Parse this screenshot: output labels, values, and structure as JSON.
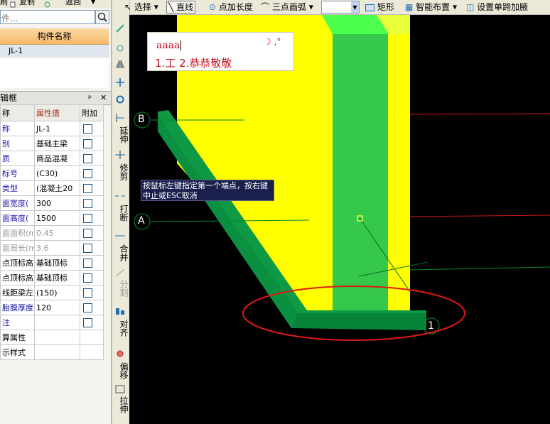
{
  "top_left_toolbar": {
    "item1": "刷",
    "item2": "复制",
    "item3": "返回"
  },
  "search": {
    "value": "件..."
  },
  "components": {
    "header": "构件名称",
    "items": [
      "JL-1"
    ]
  },
  "properties": {
    "title": "辑框",
    "pin": "ᵖ",
    "close": "✕",
    "columns": {
      "name": "称",
      "value": "属性值",
      "extra": "附加"
    },
    "rows": [
      {
        "name": "称",
        "value": "JL-1",
        "name_style": "blue",
        "value_style": "",
        "check": false
      },
      {
        "name": "别",
        "value": "基础主梁",
        "name_style": "blue",
        "value_style": "",
        "check": true
      },
      {
        "name": "质",
        "value": "商品混凝",
        "name_style": "blue",
        "value_style": "",
        "check": true
      },
      {
        "name": "标号",
        "value": "(C30)",
        "name_style": "blue",
        "value_style": "",
        "check": true
      },
      {
        "name": "类型",
        "value": "(混凝土20",
        "name_style": "blue",
        "value_style": "",
        "check": true
      },
      {
        "name": "面宽度(",
        "value": "300",
        "name_style": "blue",
        "value_style": "",
        "check": true
      },
      {
        "name": "面高度(",
        "value": "1500",
        "name_style": "blue",
        "value_style": "",
        "check": true
      },
      {
        "name": "面面积(m",
        "value": "0.45",
        "name_style": "grey",
        "value_style": "grey",
        "check": true
      },
      {
        "name": "面周长(m",
        "value": "3.6",
        "name_style": "grey",
        "value_style": "grey",
        "check": true
      },
      {
        "name": "点顶标高",
        "value": "基础顶标",
        "name_style": "",
        "value_style": "",
        "check": true
      },
      {
        "name": "点顶标高",
        "value": "基础顶标",
        "name_style": "",
        "value_style": "",
        "check": true
      },
      {
        "name": "线距梁左",
        "value": "(150)",
        "name_style": "",
        "value_style": "",
        "check": true
      },
      {
        "name": "胎膜厚度",
        "value": "120",
        "name_style": "blue",
        "value_style": "",
        "check": true
      },
      {
        "name": "注",
        "value": "",
        "name_style": "blue",
        "value_style": "",
        "check": true
      },
      {
        "name": "算属性",
        "value": "",
        "name_style": "",
        "value_style": "",
        "check": null
      },
      {
        "name": "示样式",
        "value": "",
        "name_style": "",
        "value_style": "",
        "check": null
      }
    ]
  },
  "vertical_toolbar": {
    "extend": "延伸",
    "trim": "修剪",
    "break": "打断",
    "merge": "合并",
    "split": "分割",
    "align": "对齐",
    "offset": "偏移",
    "stretch": "拉伸"
  },
  "toolbar": {
    "select": "选择",
    "line": "直线",
    "point_length": "点加长度",
    "arc3": "三点画弧",
    "rect": "矩形",
    "smart_layout": "智能布置",
    "set_haunch": "设置单跨加腋"
  },
  "canvas": {
    "axis_b": "B",
    "axis_a": "A",
    "axis_1": "1",
    "hint_text": "按鼠标左键指定第一个端点，按右键中止或ESC取消",
    "ime_input": "aaaa",
    "ime_candidates": "1.工 2.恭恭敬敬",
    "ime_icons": "☽ ,°"
  },
  "colors": {
    "yellow": "#ffff00",
    "dark_green": "#0a8a3c",
    "green": "#35c84a",
    "light_green": "#4dff4d",
    "ellipse": "#e01818",
    "background": "#000000"
  }
}
